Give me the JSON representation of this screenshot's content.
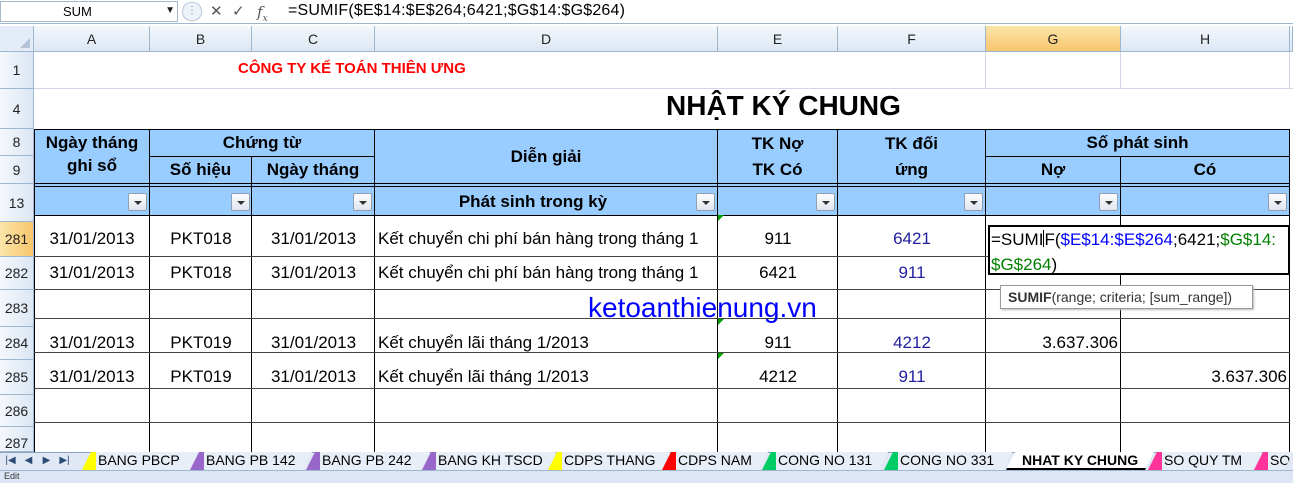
{
  "formula_bar": {
    "name_box": "SUM",
    "formula": "=SUMIF($E$14:$E$264;6421;$G$14:$G$264)"
  },
  "icons": [
    "name-box-dropdown-icon",
    "cancel-icon",
    "enter-icon",
    "insert-function-icon",
    "filter-dropdown-icon",
    "sheet-nav-icon"
  ],
  "columns": [
    "A",
    "B",
    "C",
    "D",
    "E",
    "F",
    "G",
    "H"
  ],
  "rows": {
    "r1": "1",
    "r4": "4",
    "r8": "8",
    "r9": "9",
    "r13": "13",
    "r281": "281",
    "r282": "282",
    "r283": "283",
    "r284": "284",
    "r285": "285",
    "r286": "286",
    "r287": "287"
  },
  "sheet": {
    "company": "CÔNG TY KẾ TOÁN THIÊN ƯNG",
    "title": "NHẬT KÝ CHUNG",
    "headers": {
      "date_a1": "Ngày tháng",
      "date_a2": "ghi sổ",
      "voucher": "Chứng từ",
      "voucher_no": "Số hiệu",
      "voucher_date": "Ngày tháng",
      "description": "Diễn giải",
      "acct_1": "TK Nợ",
      "acct_2": "TK Có",
      "counter_1": "TK đối",
      "counter_2": "ứng",
      "amount": "Số phát sinh",
      "debit": "Nợ",
      "credit": "Có"
    },
    "filter_row_label": "Phát sinh trong kỳ",
    "watermark": "ketoanthienung.vn",
    "data_rows": [
      {
        "date": "31/01/2013",
        "no": "PKT018",
        "vdate": "31/01/2013",
        "desc": "Kết chuyển chi phí bán hàng trong tháng 1",
        "acct": "911",
        "counter": "6421",
        "debit": "",
        "credit": ""
      },
      {
        "date": "31/01/2013",
        "no": "PKT018",
        "vdate": "31/01/2013",
        "desc": "Kết chuyển chi phí bán hàng trong tháng 1",
        "acct": "6421",
        "counter": "911",
        "debit": "",
        "credit": ""
      },
      {
        "date": "",
        "no": "",
        "vdate": "",
        "desc": "",
        "acct": "",
        "counter": "",
        "debit": "",
        "credit": ""
      },
      {
        "date": "31/01/2013",
        "no": "PKT019",
        "vdate": "31/01/2013",
        "desc": "Kết chuyển lãi  tháng 1/2013",
        "acct": "911",
        "counter": "4212",
        "debit": "3.637.306",
        "credit": ""
      },
      {
        "date": "31/01/2013",
        "no": "PKT019",
        "vdate": "31/01/2013",
        "desc": "Kết chuyển lãi  tháng 1/2013",
        "acct": "4212",
        "counter": "911",
        "debit": "",
        "credit": "3.637.306"
      }
    ],
    "edit_cell": {
      "p1": "=SUMI",
      "p2": "F(",
      "p3": "$E$14:$E$264",
      "p4": ";6421;",
      "p5": "$G$14:",
      "p6": "$G$264",
      "p7": ")"
    },
    "tooltip": {
      "fn": "SUMIF",
      "args": "(range; criteria; [sum_range])"
    }
  },
  "tabs": [
    {
      "label": "BANG PBCP",
      "color": "#ffff00",
      "active": false
    },
    {
      "label": "BANG PB 142",
      "color": "#9966cc",
      "active": false
    },
    {
      "label": "BANG PB 242",
      "color": "#9966cc",
      "active": false
    },
    {
      "label": "BANG KH TSCD",
      "color": "#9966cc",
      "active": false
    },
    {
      "label": "CDPS THANG",
      "color": "#ffff00",
      "active": false
    },
    {
      "label": "CDPS NAM",
      "color": "#ff0000",
      "active": false
    },
    {
      "label": "CONG NO 131",
      "color": "#00cc66",
      "active": false
    },
    {
      "label": "CONG NO 331",
      "color": "#00cc66",
      "active": false
    },
    {
      "label": "NHAT KY CHUNG",
      "color": "#ffffff",
      "active": true
    },
    {
      "label": "SO QUY TM",
      "color": "#ff3399",
      "active": false
    },
    {
      "label": "SO",
      "color": "#ff3399",
      "active": false
    }
  ],
  "status": {
    "mode": "Edit"
  },
  "colors": {
    "header_blue": "#99ccff",
    "company_red": "#ff0000",
    "watermark_blue": "#0000ff",
    "counter_blue": "#1f1f9f"
  }
}
